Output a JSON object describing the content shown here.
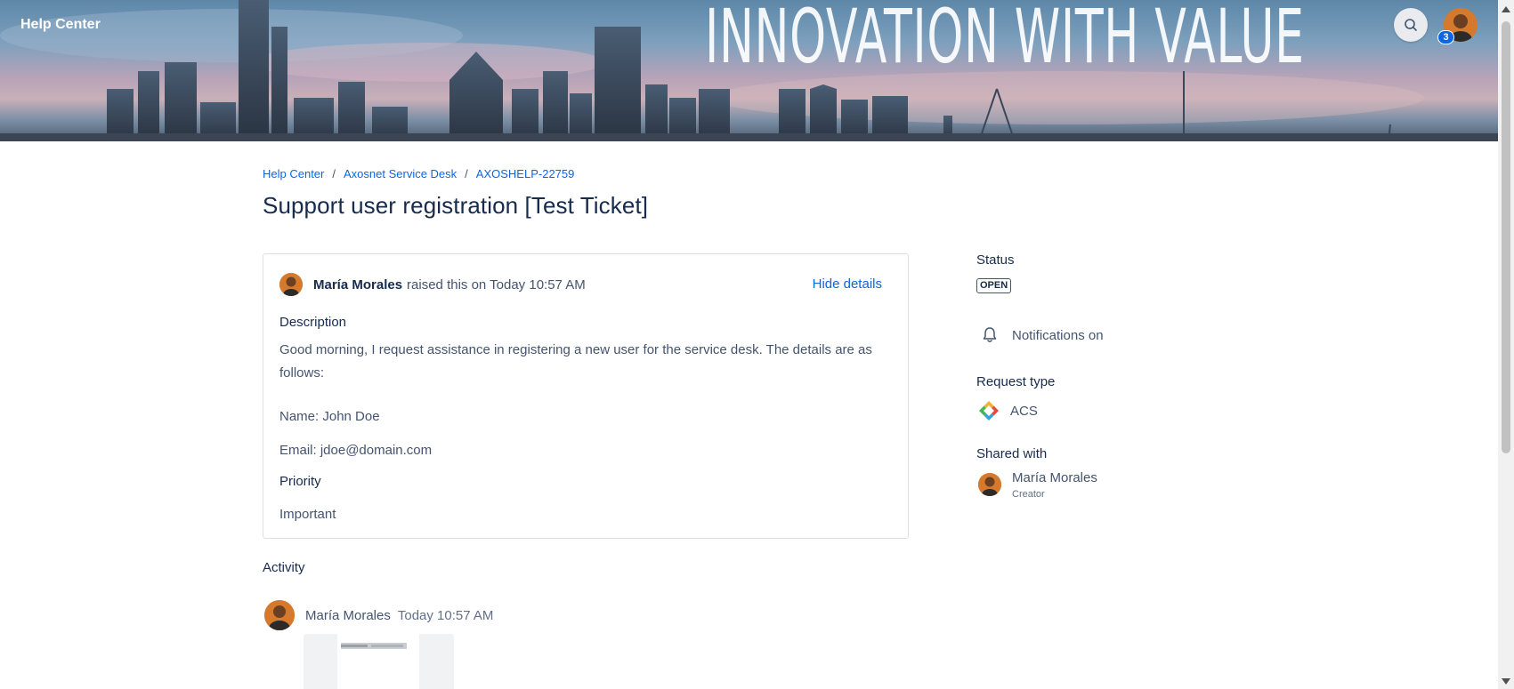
{
  "header": {
    "home_link": "Help Center",
    "banner_slogan": "INNOVATION WITH VALUE",
    "notification_count": "3",
    "search_icon": "search-icon"
  },
  "breadcrumb": {
    "items": [
      "Help Center",
      "Axosnet Service Desk",
      "AXOSHELP-22759"
    ],
    "separator": "/"
  },
  "page_title": "Support user registration [Test Ticket]",
  "request": {
    "raiser_name": "María Morales",
    "raised_text": "raised this on Today 10:57 AM",
    "hide_details_label": "Hide details",
    "description_label": "Description",
    "description_text": "Good morning, I request assistance in registering a new user for the service desk. The details are as follows:",
    "name_line": "Name: John Doe",
    "email_line": "Email: jdoe@domain.com",
    "priority_label": "Priority",
    "priority_value": "Important"
  },
  "activity": {
    "heading": "Activity",
    "entries": [
      {
        "author": "María Morales",
        "time": "Today 10:57 AM"
      }
    ]
  },
  "sidebar": {
    "status_label": "Status",
    "status_value": "OPEN",
    "notifications_label": "Notifications on",
    "request_type_label": "Request type",
    "request_type_value": "ACS",
    "shared_with_label": "Shared with",
    "shared_name": "María Morales",
    "shared_role": "Creator"
  },
  "colors": {
    "link": "#0c66e4",
    "text": "#172b4d",
    "subtle_text": "#44546f",
    "badge": "#0c66e4"
  }
}
